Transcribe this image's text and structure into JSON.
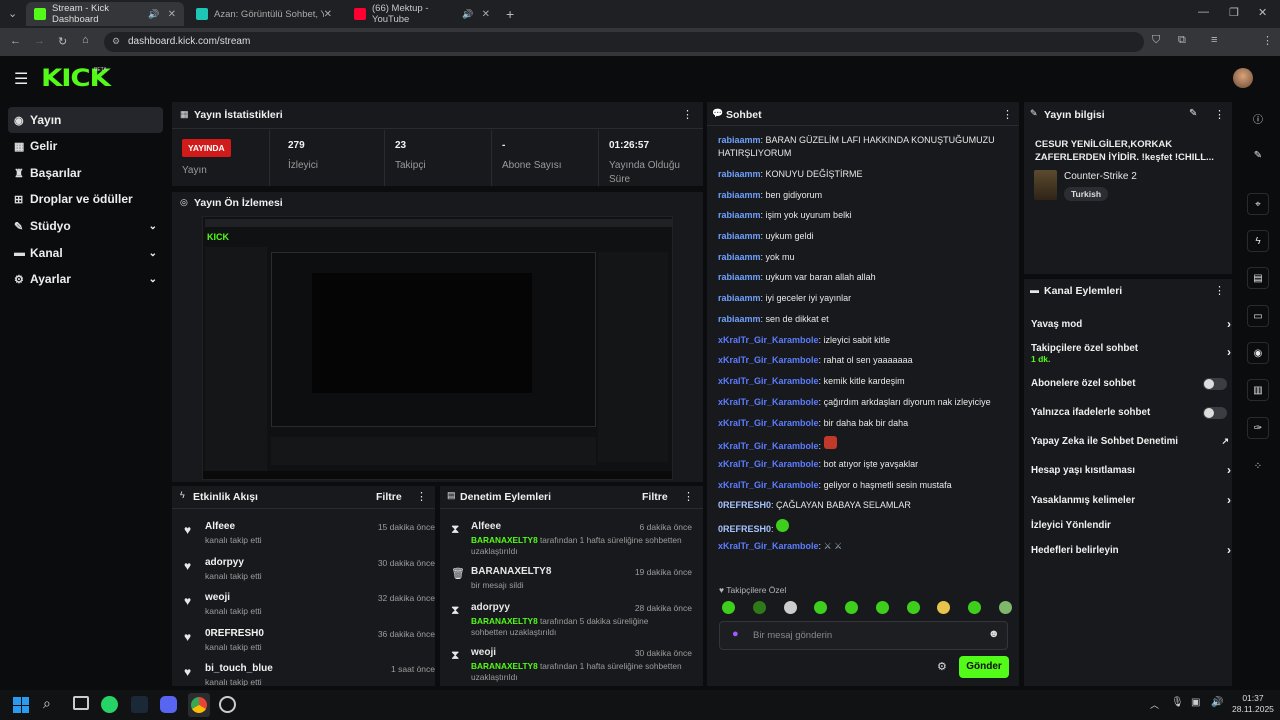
{
  "browser": {
    "tabs": [
      {
        "title": "Stream - Kick Dashboard",
        "icon": "kick-icon"
      },
      {
        "title": "Azan: Görüntülü Sohbet, Yeni A",
        "icon": "chat-icon"
      },
      {
        "title": "(66) Mektup - YouTube",
        "icon": "youtube-icon"
      }
    ],
    "url": "dashboard.kick.com/stream"
  },
  "kick": {
    "logo": "KICK",
    "beta": "BETA"
  },
  "sidebar": {
    "items": [
      {
        "label": "Yayın"
      },
      {
        "label": "Gelir"
      },
      {
        "label": "Başarılar"
      },
      {
        "label": "Droplar ve ödüller"
      },
      {
        "label": "Stüdyo"
      },
      {
        "label": "Kanal"
      },
      {
        "label": "Ayarlar"
      }
    ]
  },
  "stats": {
    "title": "Yayın İstatistikleri",
    "live_badge": "YAYINDA",
    "live_label": "Yayın",
    "viewers_val": "279",
    "viewers_lbl": "İzleyici",
    "followers_val": "23",
    "followers_lbl": "Takipçi",
    "subs_val": "-",
    "subs_lbl": "Abone Sayısı",
    "duration_val": "01:26:57",
    "duration_lbl_1": "Yayında Olduğu",
    "duration_lbl_2": "Süre"
  },
  "preview": {
    "title": "Yayın Ön İzlemesi"
  },
  "activity": {
    "title": "Etkinlik Akışı",
    "filter": "Filtre",
    "rows": [
      {
        "name": "Alfeee",
        "desc": "kanalı takip etti",
        "time": "15 dakika önce"
      },
      {
        "name": "adorpyy",
        "desc": "kanalı takip etti",
        "time": "30 dakika önce"
      },
      {
        "name": "weoji",
        "desc": "kanalı takip etti",
        "time": "32 dakika önce"
      },
      {
        "name": "0REFRESH0",
        "desc": "kanalı takip etti",
        "time": "36 dakika önce"
      },
      {
        "name": "bi_touch_blue",
        "desc": "kanalı takip etti",
        "time": "1 saat önce"
      }
    ]
  },
  "moderation": {
    "title": "Denetim Eylemleri",
    "filter": "Filtre",
    "rows": [
      {
        "name": "Alfeee",
        "mod": "BARANAXELTY8",
        "desc1": " tarafından 1 hafta süreliğine sohbetten",
        "desc2": "uzaklaştırıldı",
        "time": "6 dakika önce"
      },
      {
        "name": "BARANAXELTY8",
        "mod": "",
        "desc1": "bir mesajı sildi",
        "desc2": "",
        "time": "19 dakika önce"
      },
      {
        "name": "adorpyy",
        "mod": "BARANAXELTY8",
        "desc1": " tarafından 5 dakika süreliğine",
        "desc2": "sohbetten uzaklaştırıldı",
        "time": "28 dakika önce"
      },
      {
        "name": "weoji",
        "mod": "BARANAXELTY8",
        "desc1": " tarafından 1 hafta süreliğine sohbetten",
        "desc2": "uzaklaştırıldı",
        "time": "30 dakika önce"
      }
    ]
  },
  "chat": {
    "title": "Sohbet",
    "messages": [
      {
        "user": "rabiaamm",
        "text": "BARAN GÜZELİM LAFI HAKKINDA KONUŞTUĞUMUZU",
        "text2": "HATIRŞLIYORUM"
      },
      {
        "user": "rabiaamm",
        "text": "KONUYU DEĞİŞTİRME"
      },
      {
        "user": "rabiaamm",
        "text": "ben gidiyorum"
      },
      {
        "user": "rabiaamm",
        "text": "işim yok uyurum belki"
      },
      {
        "user": "rabiaamm",
        "text": "uykum geldi"
      },
      {
        "user": "rabiaamm",
        "text": "yok mu"
      },
      {
        "user": "rabiaamm",
        "text": "uykum var baran allah allah"
      },
      {
        "user": "rabiaamm",
        "text": "iyi geceler iyi yayınlar"
      },
      {
        "user": "rabiaamm",
        "text": "sen de dikkat et"
      },
      {
        "user": "xKralTr_Gir_Karambole",
        "text": "izleyici sabit kitle"
      },
      {
        "user": "xKralTr_Gir_Karambole",
        "text": "rahat ol sen yaaaaaaa"
      },
      {
        "user": "xKralTr_Gir_Karambole",
        "text": "kemik kitle kardeşim"
      },
      {
        "user": "xKralTr_Gir_Karambole",
        "text": "çağırdım arkdaşları diyorum nak izleyiciye"
      },
      {
        "user": "xKralTr_Gir_Karambole",
        "text": "bir daha bak bir daha"
      },
      {
        "user": "xKralTr_Gir_Karambole",
        "text": ""
      },
      {
        "user": "xKralTr_Gir_Karambole",
        "text": "bot atıyor işte yavşaklar"
      },
      {
        "user": "xKralTr_Gir_Karambole",
        "text": "geliyor o haşmetli sesin mustafa"
      },
      {
        "user": "0REFRESH0",
        "text": "ÇAĞLAYAN BABAYA SELAMLAR"
      },
      {
        "user": "0REFRESH0",
        "text": ""
      },
      {
        "user": "xKralTr_Gir_Karambole",
        "text": ""
      }
    ],
    "followers_only": "Takipçilere Özel",
    "input_placeholder": "Bir mesaj gönderin",
    "send": "Gönder"
  },
  "info": {
    "title": "Yayın bilgisi",
    "stream_title": "CESUR YENİLGİLER,KORKAK ZAFERLERDEN İYİDİR. !keşfet !CHILL...",
    "category": "Counter-Strike 2",
    "tag": "Turkish"
  },
  "actions": {
    "title": "Kanal Eylemleri",
    "items": [
      {
        "label": "Yavaş mod",
        "sub": ""
      },
      {
        "label": "Takipçilere özel sohbet",
        "sub": "1 dk."
      },
      {
        "label": "Abonelere özel sohbet",
        "sub": ""
      },
      {
        "label": "Yalnızca ifadelerle sohbet",
        "sub": ""
      },
      {
        "label": "Yapay Zeka ile Sohbet Denetimi",
        "sub": ""
      },
      {
        "label": "Hesap yaşı kısıtlaması",
        "sub": ""
      },
      {
        "label": "Yasaklanmış kelimeler",
        "sub": ""
      },
      {
        "label": "İzleyici Yönlendir",
        "sub": ""
      },
      {
        "label": "Hedefleri belirleyin",
        "sub": ""
      }
    ]
  },
  "taskbar": {
    "time": "01:37",
    "date": "28.11.2025"
  },
  "colors": {
    "brand": "#53fc18",
    "live": "#d11a1a",
    "panel": "#18191c"
  }
}
